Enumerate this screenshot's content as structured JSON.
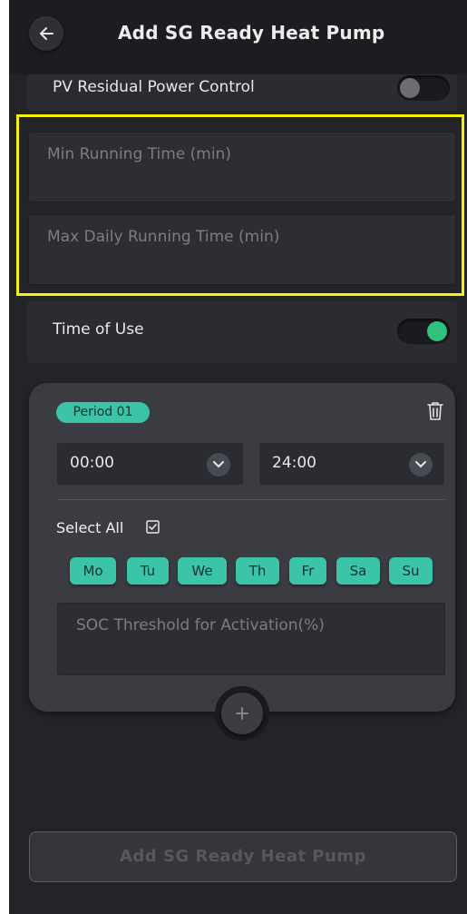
{
  "header": {
    "title": "Add SG Ready Heat Pump",
    "back_icon": "arrow-left-icon"
  },
  "pv_control": {
    "label": "PV Residual Power Control",
    "enabled": false
  },
  "fields": {
    "min_running_placeholder": "Min Running Time (min)",
    "max_daily_placeholder": "Max Daily Running Time (min)"
  },
  "time_of_use": {
    "label": "Time of Use",
    "enabled": true
  },
  "period": {
    "badge": "Period 01",
    "start_time": "00:00",
    "end_time": "24:00",
    "select_all": "Select All",
    "days": [
      "Mo",
      "Tu",
      "We",
      "Th",
      "Fr",
      "Sa",
      "Su"
    ],
    "soc_placeholder": "SOC Threshold for Activation(%)"
  },
  "submit": {
    "label": "Add SG Ready Heat Pump"
  },
  "colors": {
    "accent": "#3cc4a9",
    "toggle_on": "#2ec27e",
    "highlight": "#f6f20a"
  }
}
